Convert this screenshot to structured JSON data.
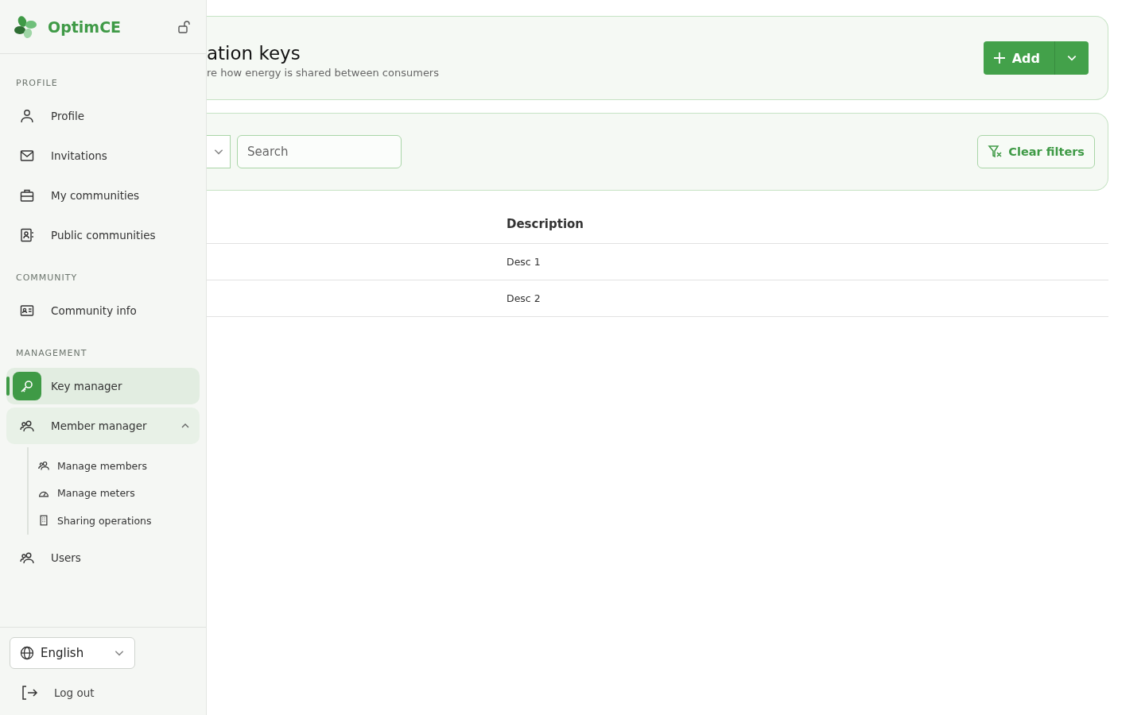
{
  "sidebar": {
    "brand": "OptimCE",
    "sections": [
      {
        "heading": "PROFILE",
        "items": [
          {
            "label": "Profile",
            "selected": false
          },
          {
            "label": "Invitations",
            "selected": false
          },
          {
            "label": "My communities",
            "selected": false
          },
          {
            "label": "Public communities",
            "selected": false
          }
        ]
      },
      {
        "heading": "COMMUNITY",
        "items": [
          {
            "label": "Community info",
            "selected": false
          }
        ]
      },
      {
        "heading": "MANAGEMENT",
        "items": [
          {
            "label": "Key manager",
            "selected": true
          },
          {
            "label": "Member manager",
            "selected": false,
            "expanded": true,
            "children": [
              {
                "label": "Manage members",
                "selected": false
              },
              {
                "label": "Manage meters",
                "selected": false
              },
              {
                "label": "Sharing operations",
                "selected": false
              }
            ]
          },
          {
            "label": "Users",
            "selected": false
          }
        ]
      }
    ],
    "language": "English",
    "logout": "Log out"
  },
  "header": {
    "title": "ation keys",
    "subtitle": "re how energy is shared between consumers",
    "add_button": "Add"
  },
  "filters": {
    "search": {
      "placeholder": "Search"
    },
    "clear_button": "Clear filters"
  },
  "table": {
    "columns": [
      "Description"
    ],
    "rows": [
      {
        "description": "Desc 1"
      },
      {
        "description": "Desc 2"
      }
    ]
  }
}
